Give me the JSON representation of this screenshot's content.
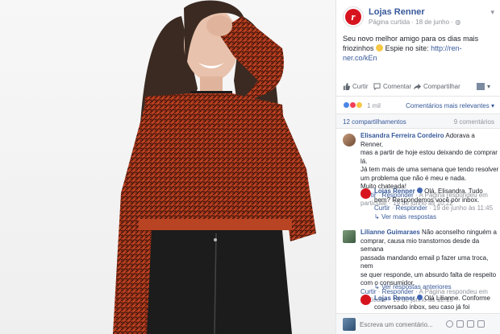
{
  "page": {
    "name": "Lojas Renner",
    "type": "Página curtida",
    "date": "18 de junho",
    "chevron": "▾"
  },
  "post": {
    "line1": "Seu novo melhor amigo para os dias mais",
    "line2": "friozinhos",
    "line2b": "Espie no site:",
    "link": "http://ren-ner.co/kEn"
  },
  "actions": {
    "like": "Curtir",
    "comment": "Comentar",
    "share": "Compartilhar"
  },
  "reactions": {
    "count": "1 mil",
    "relevance": "Comentários mais relevantes ▾"
  },
  "shares": {
    "shares": "12 compartilhamentos",
    "comments": "9 comentários"
  },
  "comments": [
    {
      "name": "Elisandra Ferreira Cordeiro",
      "lines": [
        "Adorava a Renner,",
        "mas a partir de hoje estou deixando de comprar lá.",
        "Já tem mais de uma semana que tendo resolver",
        "um problema que não é meu e nada.",
        "Muito chateada!"
      ],
      "like": "Curtir",
      "reply": "Responder",
      "responded": "A Página respondeu em",
      "responded2": "particular",
      "time": "19 de junho às 10:22",
      "reply_obj": {
        "name": "Lojas Renner",
        "lines": [
          "Olá, Elisandra. Tudo",
          "bem? Respondemos você por inbox."
        ],
        "like": "Curtir",
        "reply": "Responder",
        "time": "19 de junho às 11:45"
      },
      "more": "Ver mais respostas"
    },
    {
      "name": "Lilianne Guimaraes",
      "lines": [
        "Não aconselho ninguém a",
        "comprar, causa mio transtornos desde da semana",
        "passada mandando email p fazer uma troca, nem",
        "se quer responde, um absurdo falta de respeito",
        "com o consumidor."
      ],
      "like": "Curtir",
      "reply": "Responder",
      "responded": "A Página respondeu em",
      "responded2": "particular",
      "time": "19 de junho às 12:15",
      "more": "Ver respostas anteriores",
      "reply_obj": {
        "name": "Lojas Renner",
        "lines": [
          "Olá Lilianne. Conforme",
          "conversado inbox, seu caso já foi"
        ]
      }
    }
  ],
  "composer": {
    "placeholder": "Escreva um comentário..."
  }
}
